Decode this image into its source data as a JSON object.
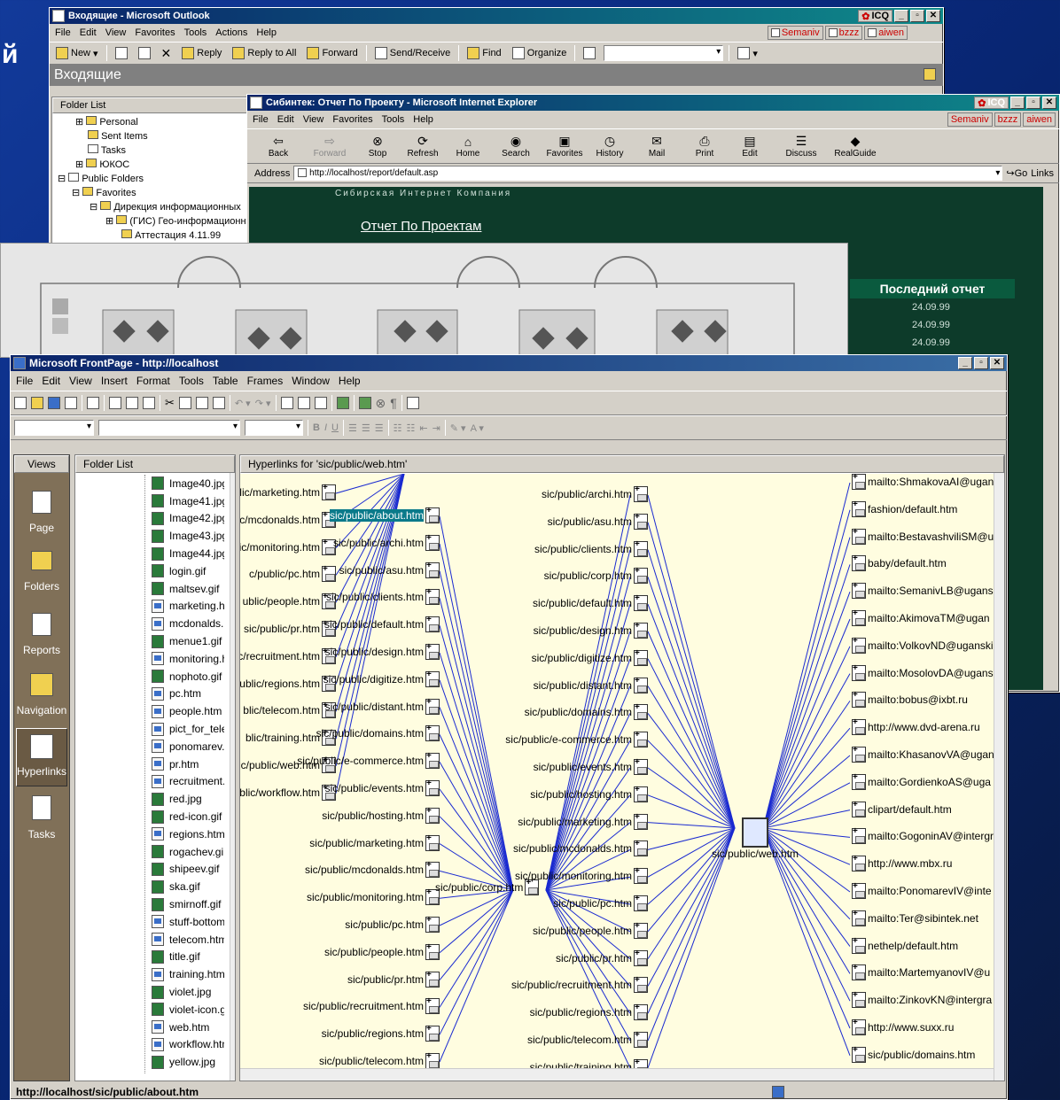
{
  "background_text": "й",
  "outlook": {
    "title": "Входящие - Microsoft Outlook",
    "icq_label": "ICQ",
    "menu": [
      "File",
      "Edit",
      "View",
      "Favorites",
      "Tools",
      "Actions",
      "Help"
    ],
    "toolbar": [
      "New",
      "Reply",
      "Reply to All",
      "Forward",
      "Send/Receive",
      "Find",
      "Organize"
    ],
    "users": [
      "Semaniv",
      "bzzz",
      "aiwen"
    ],
    "banner": "Входящие",
    "folder_list_title": "Folder List",
    "folders": [
      "Personal",
      "Sent Items",
      "Tasks",
      "ЮКОС",
      "Public Folders",
      "Favorites",
      "Дирекция информационных",
      "(ГИС) Гео-информационн",
      "Аттестация 4.11.99"
    ]
  },
  "ie": {
    "title": "Сибинтек: Отчет По Проекту - Microsoft Internet Explorer",
    "icq_label": "ICQ",
    "menu": [
      "File",
      "Edit",
      "View",
      "Favorites",
      "Tools",
      "Help"
    ],
    "users": [
      "Semaniv",
      "bzzz",
      "aiwen"
    ],
    "toolbar": [
      "Back",
      "Forward",
      "Stop",
      "Refresh",
      "Home",
      "Search",
      "Favorites",
      "History",
      "Mail",
      "Print",
      "Edit",
      "Discuss",
      "RealGuide"
    ],
    "address_label": "Address",
    "address": "http://localhost/report/default.asp",
    "go": "Go",
    "links": "Links",
    "company": "Сибирская Интернет Компания",
    "heading": "Отчет По Проектам",
    "last_report_label": "Последний отчет",
    "dates": [
      "24.09.99",
      "24.09.99",
      "24.09.99"
    ]
  },
  "frontpage": {
    "title": "Microsoft FrontPage - http://localhost",
    "menu": [
      "File",
      "Edit",
      "View",
      "Insert",
      "Format",
      "Tools",
      "Table",
      "Frames",
      "Window",
      "Help"
    ],
    "views_title": "Views",
    "views": [
      "Page",
      "Folders",
      "Reports",
      "Navigation",
      "Hyperlinks",
      "Tasks"
    ],
    "folder_list_title": "Folder List",
    "files": [
      "Image40.jpg",
      "Image41.jpg",
      "Image42.jpg",
      "Image43.jpg",
      "Image44.jpg",
      "login.gif",
      "maltsev.gif",
      "marketing.h",
      "mcdonalds.l",
      "menue1.gif",
      "monitoring.h",
      "nophoto.gif",
      "pc.htm",
      "people.htm",
      "pict_for_tele",
      "ponomarev.",
      "pr.htm",
      "recruitment.",
      "red.jpg",
      "red-icon.gif",
      "regions.htm",
      "rogachev.gi",
      "shipeev.gif",
      "ska.gif",
      "smirnoff.gif",
      "stuff-bottom",
      "telecom.htm",
      "title.gif",
      "training.htm",
      "violet.jpg",
      "violet-icon.g",
      "web.htm",
      "workflow.htm",
      "yellow.jpg"
    ],
    "hyperlinks_title": "Hyperlinks for 'sic/public/web.htm'",
    "col1": [
      "lic/marketing.htm",
      "c/mcdonalds.htm",
      "ic/monitoring.htm",
      "c/public/pc.htm",
      "ublic/people.htm",
      "sic/public/pr.htm",
      "c/recruitment.htm",
      "ublic/regions.htm",
      "blic/telecom.htm",
      "blic/training.htm",
      "c/public/web.htm",
      "blic/workflow.htm"
    ],
    "col2_top": [
      "sic/public/about.htm",
      "sic/public/archi.htm",
      "sic/public/asu.htm",
      "sic/public/clients.htm",
      "sic/public/default.htm",
      "sic/public/design.htm",
      "sic/public/digitize.htm",
      "sic/public/distant.htm",
      "sic/public/domains.htm",
      "sic/public/e-commerce.htm",
      "sic/public/events.htm",
      "sic/public/hosting.htm",
      "sic/public/marketing.htm",
      "sic/public/mcdonalds.htm",
      "sic/public/monitoring.htm",
      "sic/public/pc.htm",
      "sic/public/people.htm",
      "sic/public/pr.htm",
      "sic/public/recruitment.htm",
      "sic/public/regions.htm",
      "sic/public/telecom.htm"
    ],
    "corp_node": "sic/public/corp.htm",
    "col3": [
      "sic/public/archi.htm",
      "sic/public/asu.htm",
      "sic/public/clients.htm",
      "sic/public/corp.htm",
      "sic/public/default.htm",
      "sic/public/design.htm",
      "sic/public/digitize.htm",
      "sic/public/distant.htm",
      "sic/public/domains.htm",
      "sic/public/e-commerce.htm",
      "sic/public/events.htm",
      "sic/public/hosting.htm",
      "sic/public/marketing.htm",
      "sic/public/mcdonalds.htm",
      "sic/public/monitoring.htm",
      "sic/public/pc.htm",
      "sic/public/people.htm",
      "sic/public/pr.htm",
      "sic/public/recruitment.htm",
      "sic/public/regions.htm",
      "sic/public/telecom.htm",
      "sic/public/training.htm"
    ],
    "center_node": "sic/public/web.htm",
    "col4": [
      "mailto:ShmakovaAI@ugan",
      "fashion/default.htm",
      "mailto:BestavashviliSM@u",
      "baby/default.htm",
      "mailto:SemanivLB@ugans",
      "mailto:AkimovaTM@ugan",
      "mailto:VolkovND@uganski",
      "mailto:MosolovDA@ugans",
      "mailto:bobus@ixbt.ru",
      "http://www.dvd-arena.ru",
      "mailto:KhasanovVA@ugan",
      "mailto:GordienkoAS@uga",
      "clipart/default.htm",
      "mailto:GogoninAV@intergr",
      "http://www.mbx.ru",
      "mailto:PonomarevIV@inte",
      "mailto:Ter@sibintek.net",
      "nethelp/default.htm",
      "mailto:MartemyanovIV@u",
      "mailto:ZinkovKN@intergra",
      "http://www.suxx.ru",
      "sic/public/domains.htm"
    ],
    "status_url": "http://localhost/sic/public/about.htm"
  }
}
